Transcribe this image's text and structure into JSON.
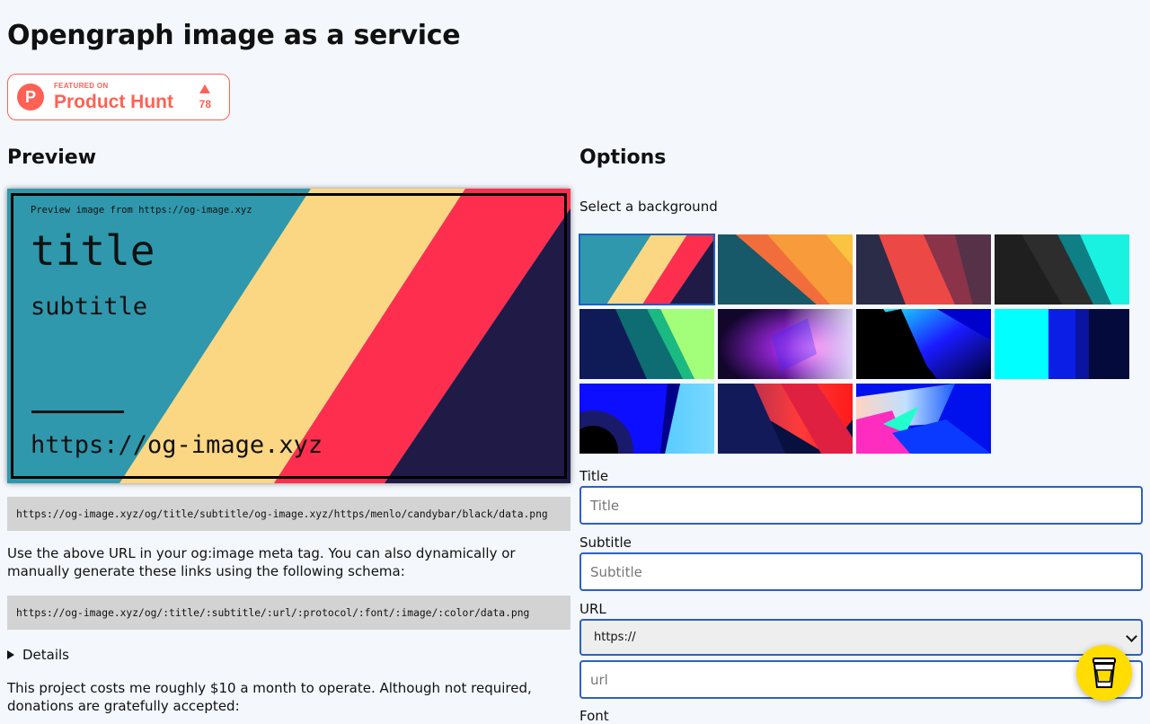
{
  "page": {
    "title": "Opengraph image as a service"
  },
  "product_hunt": {
    "featured": "FEATURED ON",
    "name": "Product Hunt",
    "logo_letter": "P",
    "votes": "78"
  },
  "preview": {
    "heading": "Preview",
    "from_text": "Preview image from https://og-image.xyz",
    "title": "title",
    "subtitle": "subtitle",
    "url": "https://og-image.xyz"
  },
  "generated_url": "https://og-image.xyz/og/title/subtitle/og-image.xyz/https/menlo/candybar/black/data.png",
  "usage_text": "Use the above URL in your og:image meta tag. You can also dynamically or manually generate these links using the following schema:",
  "schema_url": "https://og-image.xyz/og/:title/:subtitle/:url/:protocol/:font/:image/:color/data.png",
  "details_label": "Details",
  "donate_text": "This project costs me roughly $10 a month to operate. Although not required, donations are gratefully accepted:",
  "options": {
    "heading": "Options",
    "background_label": "Select a background",
    "title_label": "Title",
    "title_placeholder": "Title",
    "subtitle_label": "Subtitle",
    "subtitle_placeholder": "Subtitle",
    "url_label": "URL",
    "protocol_selected": "https://",
    "url_placeholder": "url",
    "font_label": "Font"
  },
  "colors": {
    "accent": "#2c61c2",
    "product_hunt": "#ff6154",
    "coffee": "#ffdd00"
  },
  "icons": {
    "coffee_button": "coffee-cup-icon",
    "details": "disclosure-triangle-icon"
  }
}
